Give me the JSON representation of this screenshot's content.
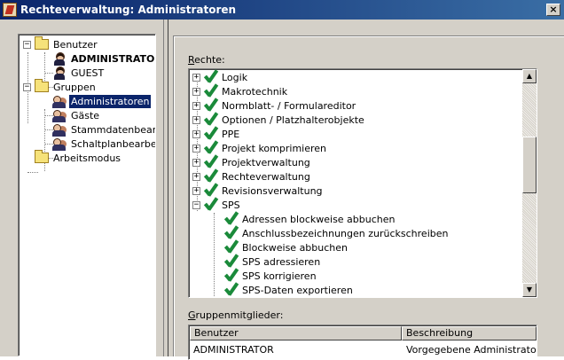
{
  "window": {
    "title": "Rechteverwaltung: Administratoren",
    "close_label": "×"
  },
  "tree": {
    "users_folder": "Benutzer",
    "users": [
      "ADMINISTRATOR",
      "GUEST"
    ],
    "groups_folder": "Gruppen",
    "groups": [
      "Administratoren",
      "Gäste",
      "Stammdatenbearbeiter",
      "Schaltplanbearbeiter"
    ],
    "workmode_folder": "Arbeitsmodus"
  },
  "rights": {
    "label_accel": "R",
    "label_rest": "echte:",
    "items": [
      {
        "label": "Logik",
        "expander": "+"
      },
      {
        "label": "Makrotechnik",
        "expander": "+"
      },
      {
        "label": "Normblatt- / Formulareditor",
        "expander": "+"
      },
      {
        "label": "Optionen / Platzhalterobjekte",
        "expander": "+"
      },
      {
        "label": "PPE",
        "expander": "+"
      },
      {
        "label": "Projekt komprimieren",
        "expander": "+"
      },
      {
        "label": "Projektverwaltung",
        "expander": "+"
      },
      {
        "label": "Rechteverwaltung",
        "expander": "+"
      },
      {
        "label": "Revisionsverwaltung",
        "expander": "+"
      },
      {
        "label": "SPS",
        "expander": "−"
      }
    ],
    "sps_children": [
      "Adressen blockweise abbuchen",
      "Anschlussbezeichnungen zurückschreiben",
      "Blockweise abbuchen",
      "SPS adressieren",
      "SPS korrigieren",
      "SPS-Daten exportieren"
    ],
    "scroll_up": "▲",
    "scroll_down": "▼"
  },
  "members": {
    "label_accel": "G",
    "label_rest": "ruppenmitglieder:",
    "columns": [
      "Benutzer",
      "Beschreibung"
    ],
    "rows": [
      [
        "ADMINISTRATOR",
        "Vorgegebene Administratorrechte"
      ]
    ]
  },
  "colors": {
    "titlebar": "#0a246a",
    "selection": "#0a246a",
    "check": "#1a8a3a",
    "face": "#d4d0c8"
  }
}
